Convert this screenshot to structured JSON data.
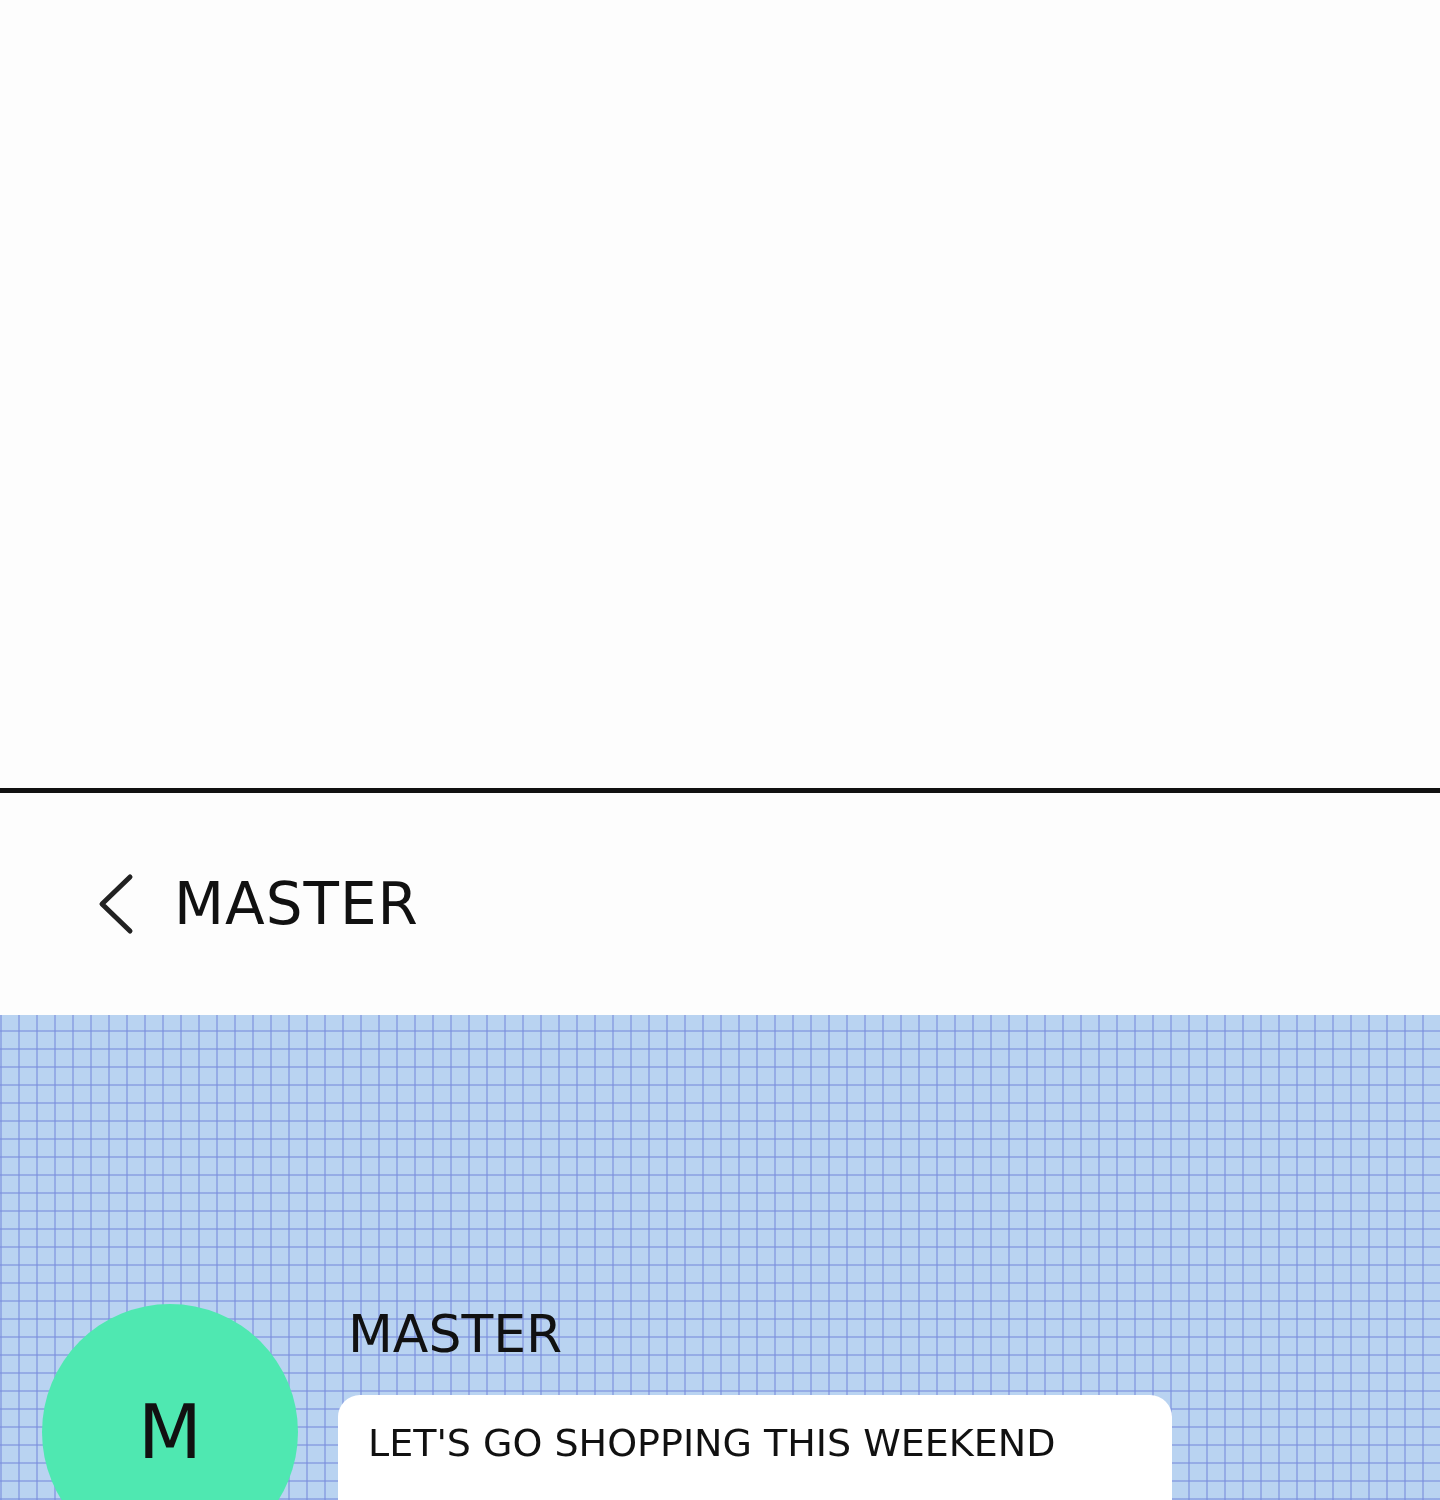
{
  "header": {
    "title": "MASTER"
  },
  "messages": [
    {
      "sender": "MASTER",
      "avatar_letter": "M",
      "text": "LET'S GO SHOPPING THIS WEEKEND"
    }
  ]
}
